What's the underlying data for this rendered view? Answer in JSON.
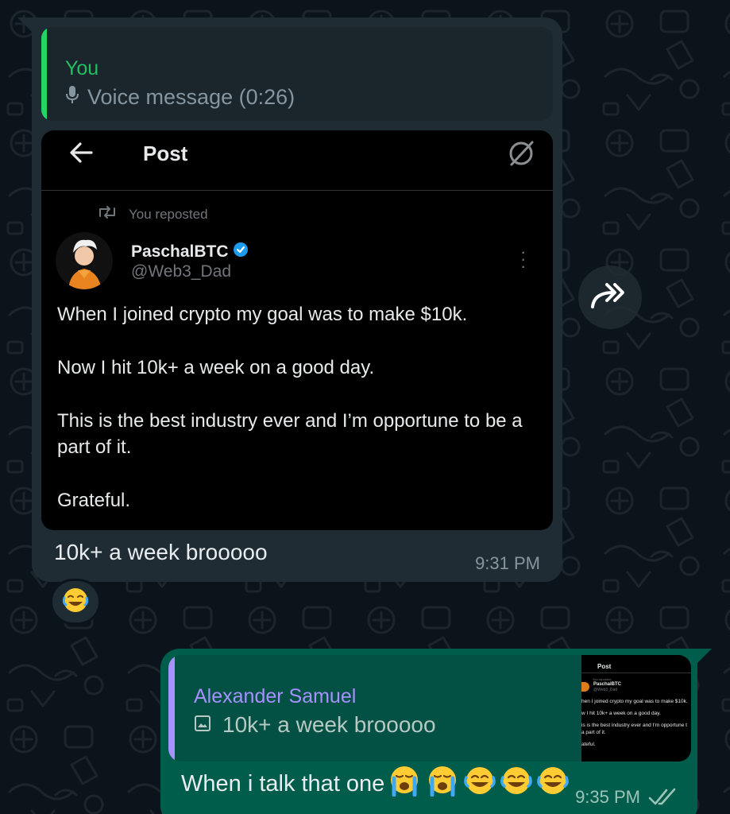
{
  "incoming": {
    "quote_author": "You",
    "quote_text": "Voice message (0:26)",
    "post": {
      "header_title": "Post",
      "repost_label": "You reposted",
      "name": "PaschalBTC",
      "handle": "@Web3_Dad",
      "paragraphs": [
        "When I joined crypto my goal was to make $10k.",
        "Now I hit 10k+ a week on a good day.",
        "This is the best industry ever and I’m opportune to be a part of it.",
        "Grateful."
      ]
    },
    "caption": "10k+ a week brooooo",
    "time": "9:31 PM",
    "reaction": "😂"
  },
  "outgoing": {
    "quote_author": "Alexander Samuel",
    "quote_text": "10k+ a week brooooo",
    "thumbnail": {
      "title": "Post",
      "repost_label": "You reposted",
      "name": "PaschalBTC",
      "handle": "@Web3_Dad",
      "lines": [
        "hen I joined crypto my goal was to make $10k.",
        "w I hit 10k+ a week on a good day.",
        "is is the best industry ever and I’m opportune t",
        "a part of it.",
        "ateful."
      ]
    },
    "text": "When i talk that one",
    "emojis": [
      "😭",
      "😭",
      "😂",
      "😂",
      "😂"
    ],
    "time": "9:35 PM"
  },
  "colors": {
    "background": "#0b141a",
    "incoming_bubble": "#202c33",
    "outgoing_bubble": "#005c4b",
    "quote_bar_you": "#25d366",
    "quote_bar_other": "#a791ff",
    "verified_badge": "#1d9bf0"
  },
  "icons": {
    "voice": "microphone-icon",
    "forward": "forward-icon",
    "back": "arrow-left-icon",
    "grok": "grok-icon",
    "repost": "repost-icon",
    "verified": "verified-badge-icon",
    "more": "more-vertical-icon",
    "image": "image-icon",
    "read_ticks": "double-check-icon"
  }
}
